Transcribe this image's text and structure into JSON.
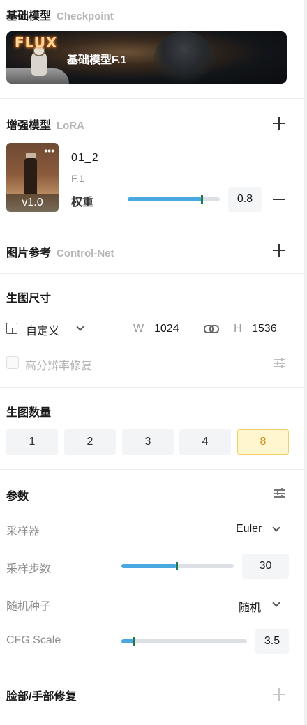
{
  "checkpoint": {
    "title": "基础模型",
    "subtitle": "Checkpoint",
    "card_logo": "FLUX",
    "model_name": "基础模型F.1"
  },
  "lora": {
    "title": "增强模型",
    "subtitle": "LoRA",
    "add_icon": "plus-icon",
    "item": {
      "name": "01_2",
      "base_model": "F.1",
      "version": "v1.0",
      "more_label": "•••",
      "weight_label": "权重",
      "weight_value": "0.8",
      "weight_fraction": 0.8,
      "remove_icon": "minus-icon"
    }
  },
  "controlnet": {
    "title": "图片参考",
    "subtitle": "Control-Net",
    "add_icon": "plus-icon"
  },
  "image_size": {
    "title": "生图尺寸",
    "mode": "自定义",
    "width_label": "W",
    "width_value": "1024",
    "height_label": "H",
    "height_value": "1536",
    "link_icon": "link-icon",
    "hires_label": "高分辨率修复",
    "hires_checked": false
  },
  "image_count": {
    "title": "生图数量",
    "options": [
      "1",
      "2",
      "3",
      "4",
      "8"
    ],
    "selected": "8"
  },
  "params": {
    "title": "参数",
    "sampler_label": "采样器",
    "sampler_value": "Euler",
    "steps_label": "采样步数",
    "steps_value": "30",
    "steps_fraction": 0.49,
    "seed_label": "随机种子",
    "seed_value": "随机",
    "cfg_label": "CFG Scale",
    "cfg_value": "3.5",
    "cfg_fraction": 0.1
  },
  "face_fix": {
    "title": "脸部/手部修复",
    "add_icon": "plus-icon"
  },
  "colors": {
    "accent_blue": "#4aa8e0",
    "selected_bg": "#fff6cf",
    "selected_border": "#f0cf63",
    "selected_text": "#d18b1c"
  }
}
